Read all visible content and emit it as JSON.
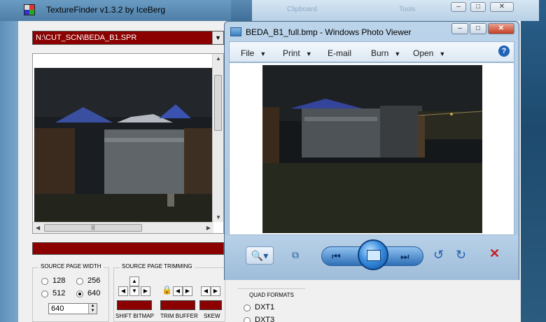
{
  "texturefinder": {
    "title": "TextureFinder v1.3.2   by   IceBerg",
    "file_path": "N:\\CUT_SCN\\BEDA_B1.SPR",
    "source_page_width": {
      "title": "SOURCE PAGE WIDTH",
      "options": [
        "128",
        "256",
        "512",
        "640"
      ],
      "selected": "640",
      "value": "640"
    },
    "source_page_trimming": {
      "title": "SOURCE PAGE TRIMMING",
      "labels": [
        "SHIFT BITMAP",
        "TRIM BUFFER",
        "SKEW"
      ]
    },
    "quad_formats": {
      "title": "QUAD FORMATS",
      "options": [
        "DXT1",
        "DXT3"
      ]
    },
    "background_ghost": [
      "Clipboard",
      "Tools"
    ]
  },
  "photo_viewer": {
    "title": "BEDA_B1_full.bmp - Windows Photo Viewer",
    "menu": [
      "File",
      "Print",
      "E-mail",
      "Burn",
      "Open"
    ],
    "help": "?"
  },
  "colors": {
    "dark_red": "#8b0000",
    "chrome_blue": "#a9c5e0",
    "accent_blue": "#2e6fb6",
    "delete_red": "#c81d1d"
  },
  "icons": [
    "app-icon",
    "zoom-icon",
    "fit-icon",
    "previous-icon",
    "slideshow-icon",
    "next-icon",
    "rotate-left-icon",
    "rotate-right-icon",
    "delete-icon",
    "help-icon",
    "lock-icon"
  ]
}
